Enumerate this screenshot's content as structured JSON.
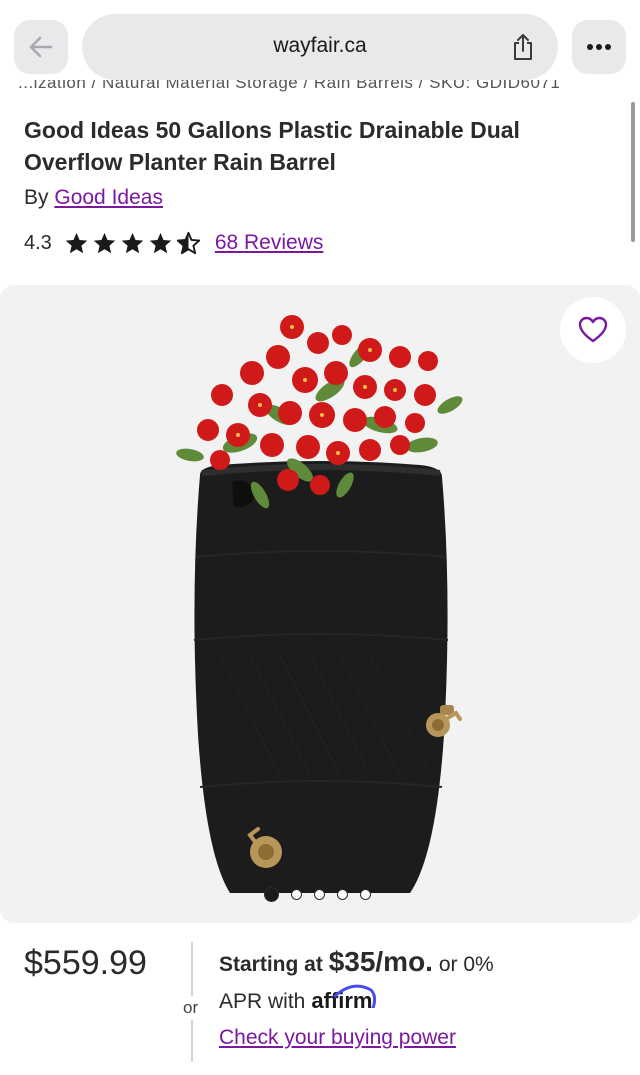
{
  "browser": {
    "url": "wayfair.ca",
    "back_icon": "arrow-left-icon",
    "share_icon": "share-icon",
    "more_icon": "ellipsis-icon"
  },
  "breadcrumb": "...ization / Natural Material Storage / Rain Barrels / SKU: GDID6071",
  "product": {
    "title": "Good Ideas 50 Gallons Plastic Drainable Dual Overflow Planter Rain Barrel",
    "by_label": "By",
    "brand": "Good Ideas",
    "rating": "4.3",
    "rating_value": 4.3,
    "reviews": "68 Reviews"
  },
  "gallery": {
    "image_count": 5,
    "active_index": 0,
    "favorite_icon": "heart-icon"
  },
  "pricing": {
    "price": "$559.99",
    "or_label": "or",
    "starting_at": "Starting at",
    "monthly": "$35/mo.",
    "or_zero": "or 0%",
    "apr_with": "APR with",
    "affirm": "affirm",
    "check_link": "Check your buying power"
  },
  "colors": {
    "link_purple": "#7b189f",
    "text": "#2b2b2b",
    "gallery_bg": "#f2f2f2"
  }
}
